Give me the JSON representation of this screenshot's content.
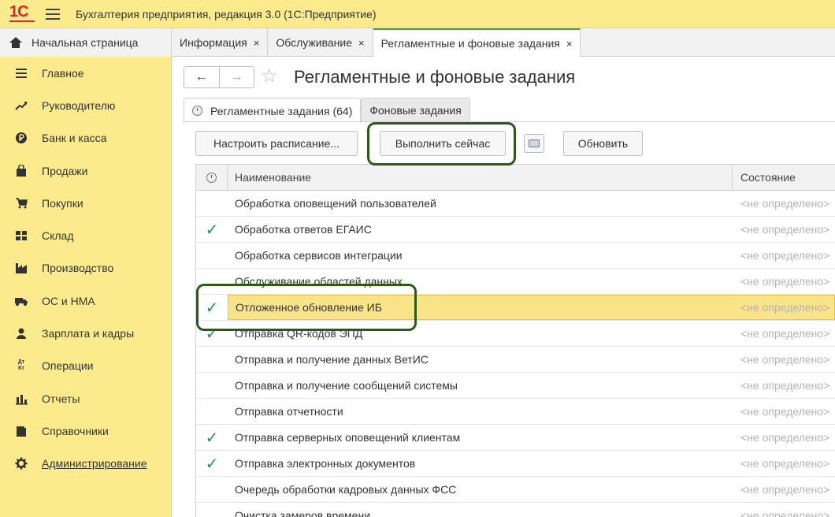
{
  "app": {
    "title": "Бухгалтерия предприятия, редакция 3.0  (1С:Предприятие)",
    "logo_text": "1С"
  },
  "tabs": [
    {
      "label": "Начальная страница",
      "closable": false
    },
    {
      "label": "Информация",
      "closable": true
    },
    {
      "label": "Обслуживание",
      "closable": true
    },
    {
      "label": "Регламентные и фоновые задания",
      "closable": true,
      "active": true
    }
  ],
  "close_glyph": "×",
  "sidebar": {
    "items": [
      {
        "label": "Главное",
        "icon": "menu-icon"
      },
      {
        "label": "Руководителю",
        "icon": "trend-icon"
      },
      {
        "label": "Банк и касса",
        "icon": "ruble-icon"
      },
      {
        "label": "Продажи",
        "icon": "bag-icon"
      },
      {
        "label": "Покупки",
        "icon": "cart-icon"
      },
      {
        "label": "Склад",
        "icon": "warehouse-icon"
      },
      {
        "label": "Производство",
        "icon": "factory-icon"
      },
      {
        "label": "ОС и НМА",
        "icon": "truck-icon"
      },
      {
        "label": "Зарплата и кадры",
        "icon": "person-icon"
      },
      {
        "label": "Операции",
        "icon": "dt-kt-icon"
      },
      {
        "label": "Отчеты",
        "icon": "bar-chart-icon"
      },
      {
        "label": "Справочники",
        "icon": "books-icon"
      },
      {
        "label": "Администрирование",
        "icon": "gear-icon",
        "link": true
      }
    ],
    "dt_kt_glyph": "Дт Кт"
  },
  "main": {
    "title": "Регламентные и фоновые задания",
    "back_glyph": "←",
    "forward_glyph": "→",
    "star_glyph": "☆",
    "subtabs": [
      {
        "label": "Регламентные задания (64)",
        "active": true
      },
      {
        "label": "Фоновые задания",
        "active": false
      }
    ],
    "buttons": {
      "schedule": "Настроить расписание...",
      "run_now": "Выполнить сейчас",
      "refresh": "Обновить"
    },
    "table": {
      "columns": [
        "Наименование",
        "Состояние"
      ],
      "check_glyph": "✓",
      "rows": [
        {
          "name": "Обработка оповещений пользователей",
          "checked": false,
          "state": "<не определено>"
        },
        {
          "name": "Обработка ответов ЕГАИС",
          "checked": true,
          "state": "<не определено>"
        },
        {
          "name": "Обработка сервисов интеграции",
          "checked": false,
          "state": "<не определено>"
        },
        {
          "name": "Обслуживание областей данных",
          "checked": false,
          "state": "<не определено>"
        },
        {
          "name": "Отложенное обновление ИБ",
          "checked": true,
          "state": "<не определено>",
          "selected": true
        },
        {
          "name": "Отправка QR-кодов ЭПД",
          "checked": true,
          "state": "<не определено>"
        },
        {
          "name": "Отправка и получение данных ВетИС",
          "checked": false,
          "state": "<не определено>"
        },
        {
          "name": "Отправка и получение сообщений системы",
          "checked": false,
          "state": "<не определено>"
        },
        {
          "name": "Отправка отчетности",
          "checked": false,
          "state": "<не определено>"
        },
        {
          "name": "Отправка серверных оповещений клиентам",
          "checked": true,
          "state": "<не определено>"
        },
        {
          "name": "Отправка электронных документов",
          "checked": true,
          "state": "<не определено>"
        },
        {
          "name": "Очередь обработки кадровых данных ФСС",
          "checked": false,
          "state": "<не определено>"
        },
        {
          "name": "Очистка замеров времени",
          "checked": false,
          "state": "<не определено>"
        }
      ]
    }
  },
  "colors": {
    "sidebar_bg": "#fbeb8c",
    "check": "#1e9a4a",
    "selected_row": "#fbe38a",
    "highlight_frame": "#2b5a17"
  }
}
